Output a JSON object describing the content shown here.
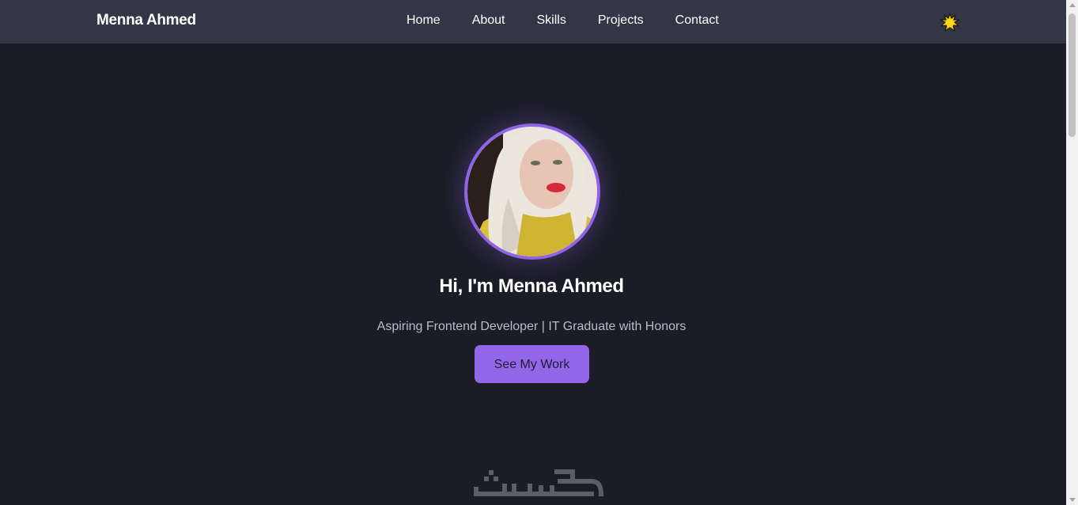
{
  "navbar": {
    "brand": "Menna Ahmed",
    "links": [
      {
        "label": "Home"
      },
      {
        "label": "About"
      },
      {
        "label": "Skills"
      },
      {
        "label": "Projects"
      },
      {
        "label": "Contact"
      }
    ],
    "theme_toggle_icon": "sun-icon"
  },
  "hero": {
    "avatar_icon": "profile-photo",
    "title": "Hi, I'm Menna Ahmed",
    "subtitle": "Aspiring Frontend Developer | IT Graduate with Honors",
    "cta_label": "See My Work"
  },
  "watermark": {
    "logo_text": "خمسات"
  },
  "colors": {
    "background": "#1b1d26",
    "navbar": "#333745",
    "accent": "#9466ea",
    "avatar_border": "#9064e6",
    "subtitle": "#b8bccb"
  }
}
